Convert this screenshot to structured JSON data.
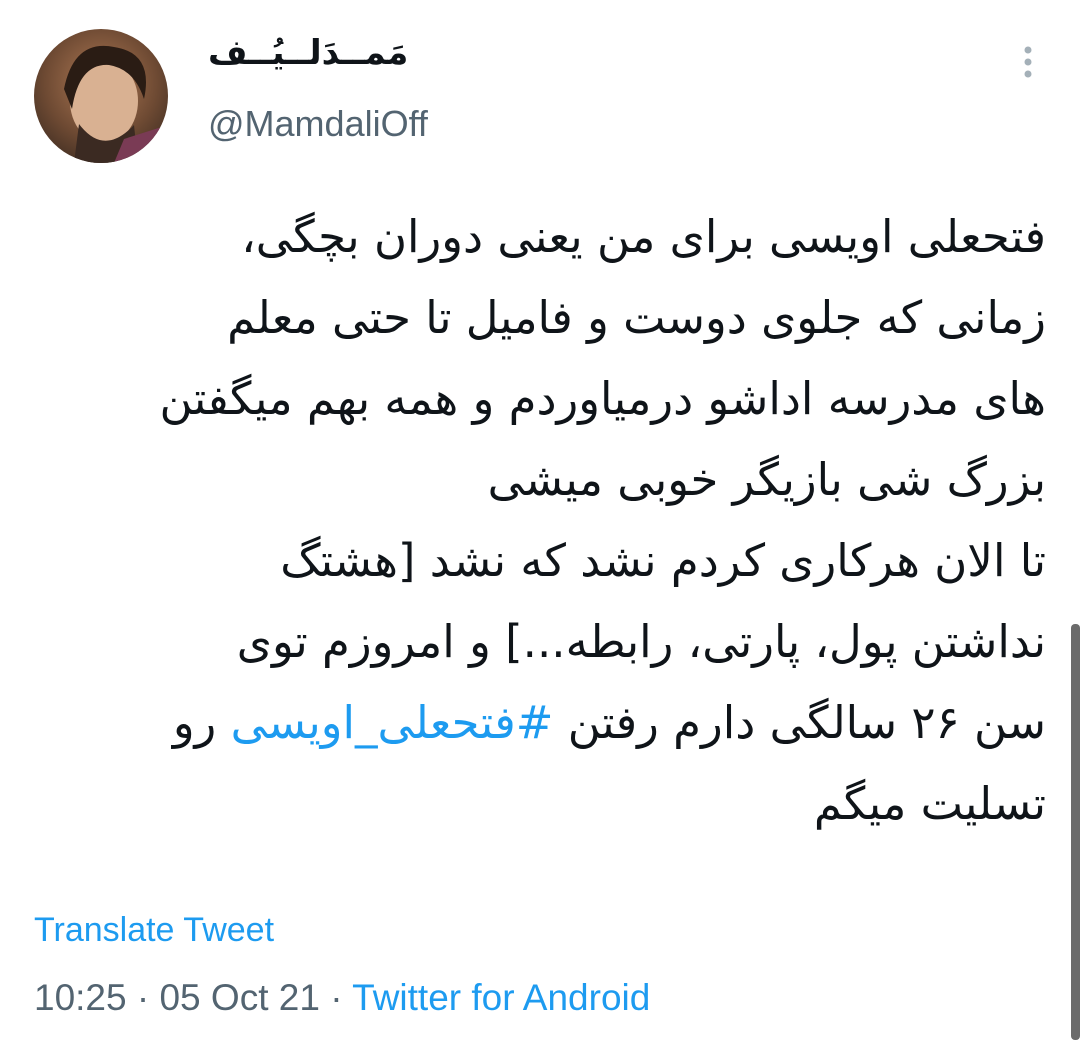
{
  "user": {
    "display_name": "مَمــدَلــیُــف",
    "handle": "@MamdaliOff"
  },
  "tweet": {
    "lines": [
      "فتحعلی اویسی برای من یعنی دوران بچگی،",
      "زمانی که جلوی دوست و فامیل تا حتی معلم",
      "های مدرسه اداشو درمیاوردم و همه بهم میگفتن",
      "بزرگ شی بازیگر خوبی میشی",
      "تا الان هرکاری کردم نشد که نشد [هشتگ",
      "نداشتن پول، پارتی، رابطه...] و امروزم توی"
    ],
    "line7_before": "سن ۲۶ سالگی دارم رفتن ",
    "hashtag": "#فتحعلی_اویسی",
    "line7_after": " رو",
    "line8": "تسلیت میگم"
  },
  "translate_label": "Translate Tweet",
  "meta": {
    "time": "10:25",
    "date": "05 Oct 21",
    "separator": " · ",
    "source": "Twitter for Android"
  },
  "icons": {
    "more": "more-vertical-icon"
  },
  "colors": {
    "link": "#1d9bf0",
    "secondary": "#536471",
    "text": "#0f1419"
  }
}
